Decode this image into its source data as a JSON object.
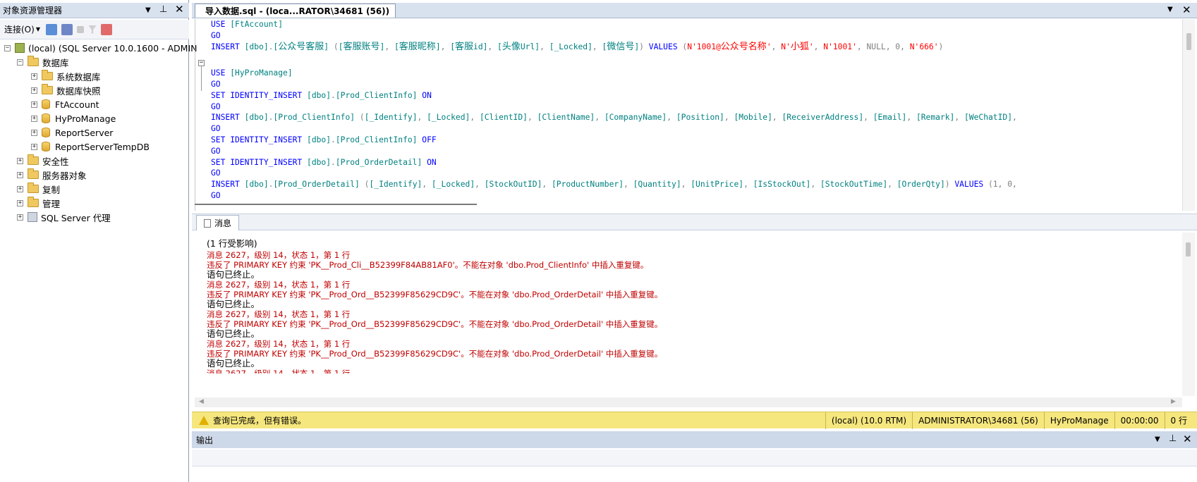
{
  "object_explorer": {
    "title": "对象资源管理器",
    "connect_label": "连接(O)",
    "tree": {
      "server": "(local) (SQL Server 10.0.1600 - ADMIN",
      "databases": "数据库",
      "system_dbs": "系统数据库",
      "snapshots": "数据库快照",
      "dbs": [
        "FtAccount",
        "HyProManage",
        "ReportServer",
        "ReportServerTempDB"
      ],
      "security": "安全性",
      "server_objects": "服务器对象",
      "replication": "复制",
      "management": "管理",
      "agent": "SQL Server 代理"
    }
  },
  "editor": {
    "tab_title": "导入数据.sql - (loca...RATOR\\34681 (56))",
    "lines": [
      [
        [
          "kw",
          "USE "
        ],
        [
          "id",
          "[FtAccount]"
        ]
      ],
      [
        [
          "kw",
          "GO"
        ]
      ],
      [
        [
          "kw",
          "INSERT "
        ],
        [
          "id",
          "[dbo]"
        ],
        [
          "gr",
          "."
        ],
        [
          "id",
          "["
        ],
        [
          "idcn",
          "公众号客服"
        ],
        [
          "id",
          "] "
        ],
        [
          "gr",
          "("
        ],
        [
          "id",
          "["
        ],
        [
          "idcn",
          "客服账号"
        ],
        [
          "id",
          "]"
        ],
        [
          "gr",
          ", "
        ],
        [
          "id",
          "["
        ],
        [
          "idcn",
          "客服昵称"
        ],
        [
          "id",
          "]"
        ],
        [
          "gr",
          ", "
        ],
        [
          "id",
          "["
        ],
        [
          "idcn",
          "客服"
        ],
        [
          "id",
          "id]"
        ],
        [
          "gr",
          ", "
        ],
        [
          "id",
          "["
        ],
        [
          "idcn",
          "头像"
        ],
        [
          "id",
          "Url]"
        ],
        [
          "gr",
          ", "
        ],
        [
          "id",
          "[_Locked]"
        ],
        [
          "gr",
          ", "
        ],
        [
          "id",
          "["
        ],
        [
          "idcn",
          "微信号"
        ],
        [
          "id",
          "]"
        ],
        [
          "gr",
          ") "
        ],
        [
          "kw",
          "VALUES "
        ],
        [
          "gr",
          "("
        ],
        [
          "st",
          "N'1001@"
        ],
        [
          "stcn",
          "公众号名称"
        ],
        [
          "st",
          "'"
        ],
        [
          "gr",
          ", "
        ],
        [
          "st",
          "N'"
        ],
        [
          "stcn",
          "小狐"
        ],
        [
          "st",
          "'"
        ],
        [
          "gr",
          ", "
        ],
        [
          "st",
          "N'1001'"
        ],
        [
          "gr",
          ", NULL, 0, "
        ],
        [
          "st",
          "N'666'"
        ],
        [
          "gr",
          ")"
        ]
      ],
      [],
      [
        [
          "kw",
          "USE "
        ],
        [
          "id",
          "[HyProManage]"
        ]
      ],
      [
        [
          "kw",
          "GO"
        ]
      ],
      [
        [
          "kw",
          "SET IDENTITY_INSERT "
        ],
        [
          "id",
          "[dbo]"
        ],
        [
          "gr",
          "."
        ],
        [
          "id",
          "[Prod_ClientInfo] "
        ],
        [
          "kw",
          "ON"
        ]
      ],
      [
        [
          "kw",
          "GO"
        ]
      ],
      [
        [
          "kw",
          "INSERT "
        ],
        [
          "id",
          "[dbo]"
        ],
        [
          "gr",
          "."
        ],
        [
          "id",
          "[Prod_ClientInfo] "
        ],
        [
          "gr",
          "("
        ],
        [
          "id",
          "[_Identify]"
        ],
        [
          "gr",
          ", "
        ],
        [
          "id",
          "[_Locked]"
        ],
        [
          "gr",
          ", "
        ],
        [
          "id",
          "[ClientID]"
        ],
        [
          "gr",
          ", "
        ],
        [
          "id",
          "[ClientName]"
        ],
        [
          "gr",
          ", "
        ],
        [
          "id",
          "[CompanyName]"
        ],
        [
          "gr",
          ", "
        ],
        [
          "id",
          "[Position]"
        ],
        [
          "gr",
          ", "
        ],
        [
          "id",
          "[Mobile]"
        ],
        [
          "gr",
          ", "
        ],
        [
          "id",
          "[ReceiverAddress]"
        ],
        [
          "gr",
          ", "
        ],
        [
          "id",
          "[Email]"
        ],
        [
          "gr",
          ", "
        ],
        [
          "id",
          "[Remark]"
        ],
        [
          "gr",
          ", "
        ],
        [
          "id",
          "[WeChatID]"
        ],
        [
          "gr",
          ","
        ]
      ],
      [
        [
          "kw",
          "GO"
        ]
      ],
      [
        [
          "kw",
          "SET IDENTITY_INSERT "
        ],
        [
          "id",
          "[dbo]"
        ],
        [
          "gr",
          "."
        ],
        [
          "id",
          "[Prod_ClientInfo] "
        ],
        [
          "kw",
          "OFF"
        ]
      ],
      [
        [
          "kw",
          "GO"
        ]
      ],
      [
        [
          "kw",
          "SET IDENTITY_INSERT "
        ],
        [
          "id",
          "[dbo]"
        ],
        [
          "gr",
          "."
        ],
        [
          "id",
          "[Prod_OrderDetail] "
        ],
        [
          "kw",
          "ON"
        ]
      ],
      [
        [
          "kw",
          "GO"
        ]
      ],
      [
        [
          "kw",
          "INSERT "
        ],
        [
          "id",
          "[dbo]"
        ],
        [
          "gr",
          "."
        ],
        [
          "id",
          "[Prod_OrderDetail] "
        ],
        [
          "gr",
          "("
        ],
        [
          "id",
          "[_Identify]"
        ],
        [
          "gr",
          ", "
        ],
        [
          "id",
          "[_Locked]"
        ],
        [
          "gr",
          ", "
        ],
        [
          "id",
          "[StockOutID]"
        ],
        [
          "gr",
          ", "
        ],
        [
          "id",
          "[ProductNumber]"
        ],
        [
          "gr",
          ", "
        ],
        [
          "id",
          "[Quantity]"
        ],
        [
          "gr",
          ", "
        ],
        [
          "id",
          "[UnitPrice]"
        ],
        [
          "gr",
          ", "
        ],
        [
          "id",
          "[IsStockOut]"
        ],
        [
          "gr",
          ", "
        ],
        [
          "id",
          "[StockOutTime]"
        ],
        [
          "gr",
          ", "
        ],
        [
          "id",
          "[OrderQty]"
        ],
        [
          "gr",
          ") "
        ],
        [
          "kw",
          "VALUES "
        ],
        [
          "gr",
          "(1, 0,"
        ]
      ],
      [
        [
          "kw",
          "GO"
        ]
      ]
    ]
  },
  "results": {
    "tab_label": "消息",
    "rows_affected": "(1 行受影响)",
    "errors": [
      {
        "head": "消息 2627，级别 14，状态 1，第 1 行",
        "body": "违反了 PRIMARY KEY 约束 'PK__Prod_Cli__B52399F84AB81AF0'。不能在对象 'dbo.Prod_ClientInfo' 中插入重复键。",
        "end": "语句已终止。"
      },
      {
        "head": "消息 2627，级别 14，状态 1，第 1 行",
        "body": "违反了 PRIMARY KEY 约束 'PK__Prod_Ord__B52399F85629CD9C'。不能在对象 'dbo.Prod_OrderDetail' 中插入重复键。",
        "end": "语句已终止。"
      },
      {
        "head": "消息 2627，级别 14，状态 1，第 1 行",
        "body": "违反了 PRIMARY KEY 约束 'PK__Prod_Ord__B52399F85629CD9C'。不能在对象 'dbo.Prod_OrderDetail' 中插入重复键。",
        "end": "语句已终止。"
      },
      {
        "head": "消息 2627，级别 14，状态 1，第 1 行",
        "body": "违反了 PRIMARY KEY 约束 'PK__Prod_Ord__B52399F85629CD9C'。不能在对象 'dbo.Prod_OrderDetail' 中插入重复键。",
        "end": "语句已终止。"
      }
    ],
    "partial_line": "消息 2627，级别 14，状态 1，第 1 行"
  },
  "status": {
    "message": "查询已完成，但有错误。",
    "server": "(local) (10.0 RTM)",
    "user": "ADMINISTRATOR\\34681 (56)",
    "database": "HyProManage",
    "time": "00:00:00",
    "rows": "0 行",
    "bar_color": "#f5e67e"
  },
  "output": {
    "title": "输出"
  }
}
